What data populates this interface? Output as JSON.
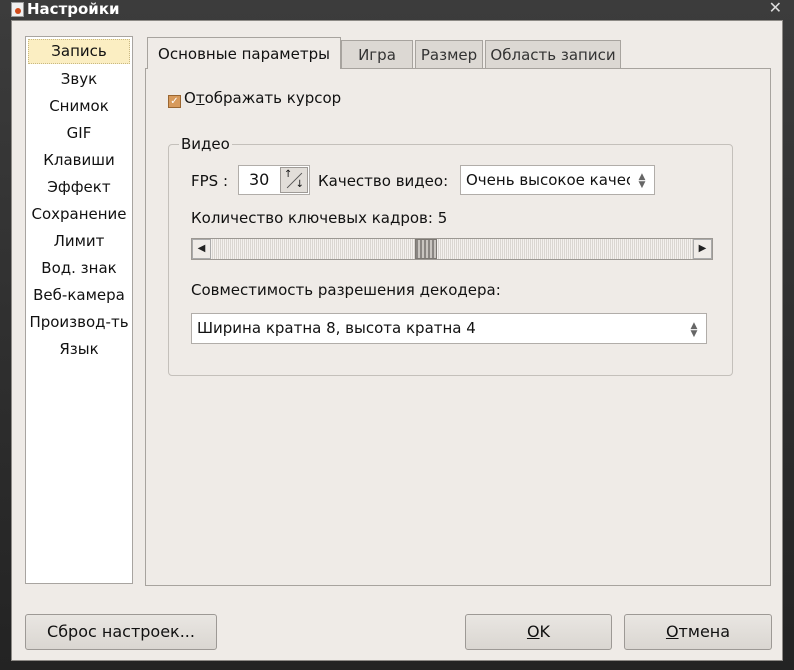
{
  "window": {
    "title": "Настройки",
    "icon": "app-icon",
    "close_glyph": "✕"
  },
  "sidebar": {
    "items": [
      {
        "label": "Запись",
        "active": true
      },
      {
        "label": "Звук"
      },
      {
        "label": "Снимок"
      },
      {
        "label": "GIF"
      },
      {
        "label": "Клавиши"
      },
      {
        "label": "Эффект"
      },
      {
        "label": "Сохранение"
      },
      {
        "label": "Лимит"
      },
      {
        "label": "Вод. знак"
      },
      {
        "label": "Веб-камера"
      },
      {
        "label": "Производ-ть"
      },
      {
        "label": "Язык"
      }
    ]
  },
  "tabs": [
    {
      "label": "Основные параметры",
      "active": true
    },
    {
      "label": "Игра"
    },
    {
      "label": "Размер"
    },
    {
      "label": "Область записи"
    }
  ],
  "main": {
    "show_cursor": {
      "pre": "О",
      "underlined": "т",
      "post": "ображать курсор",
      "checked": true
    },
    "video_group": {
      "title": "Видео",
      "fps_label": "FPS :",
      "fps_value": "30",
      "quality_label": "Качество видео:",
      "quality_value": "Очень высокое качество",
      "keyframes_label": "Количество ключевых кадров: 5",
      "keyframes_value": 5,
      "decoder_label": "Совместимость разрешения декодера:",
      "decoder_value": "Ширина кратна 8, высота кратна 4"
    }
  },
  "buttons": {
    "reset": "Сброс настроек...",
    "ok_underlined": "O",
    "ok_rest": "K",
    "cancel_underlined": "О",
    "cancel_rest": "тмена"
  },
  "colors": {
    "background": "#efebe7",
    "checkbox": "#d79a5c",
    "active_item": "#fbeec2",
    "titlebar": "#2b2b2b"
  }
}
